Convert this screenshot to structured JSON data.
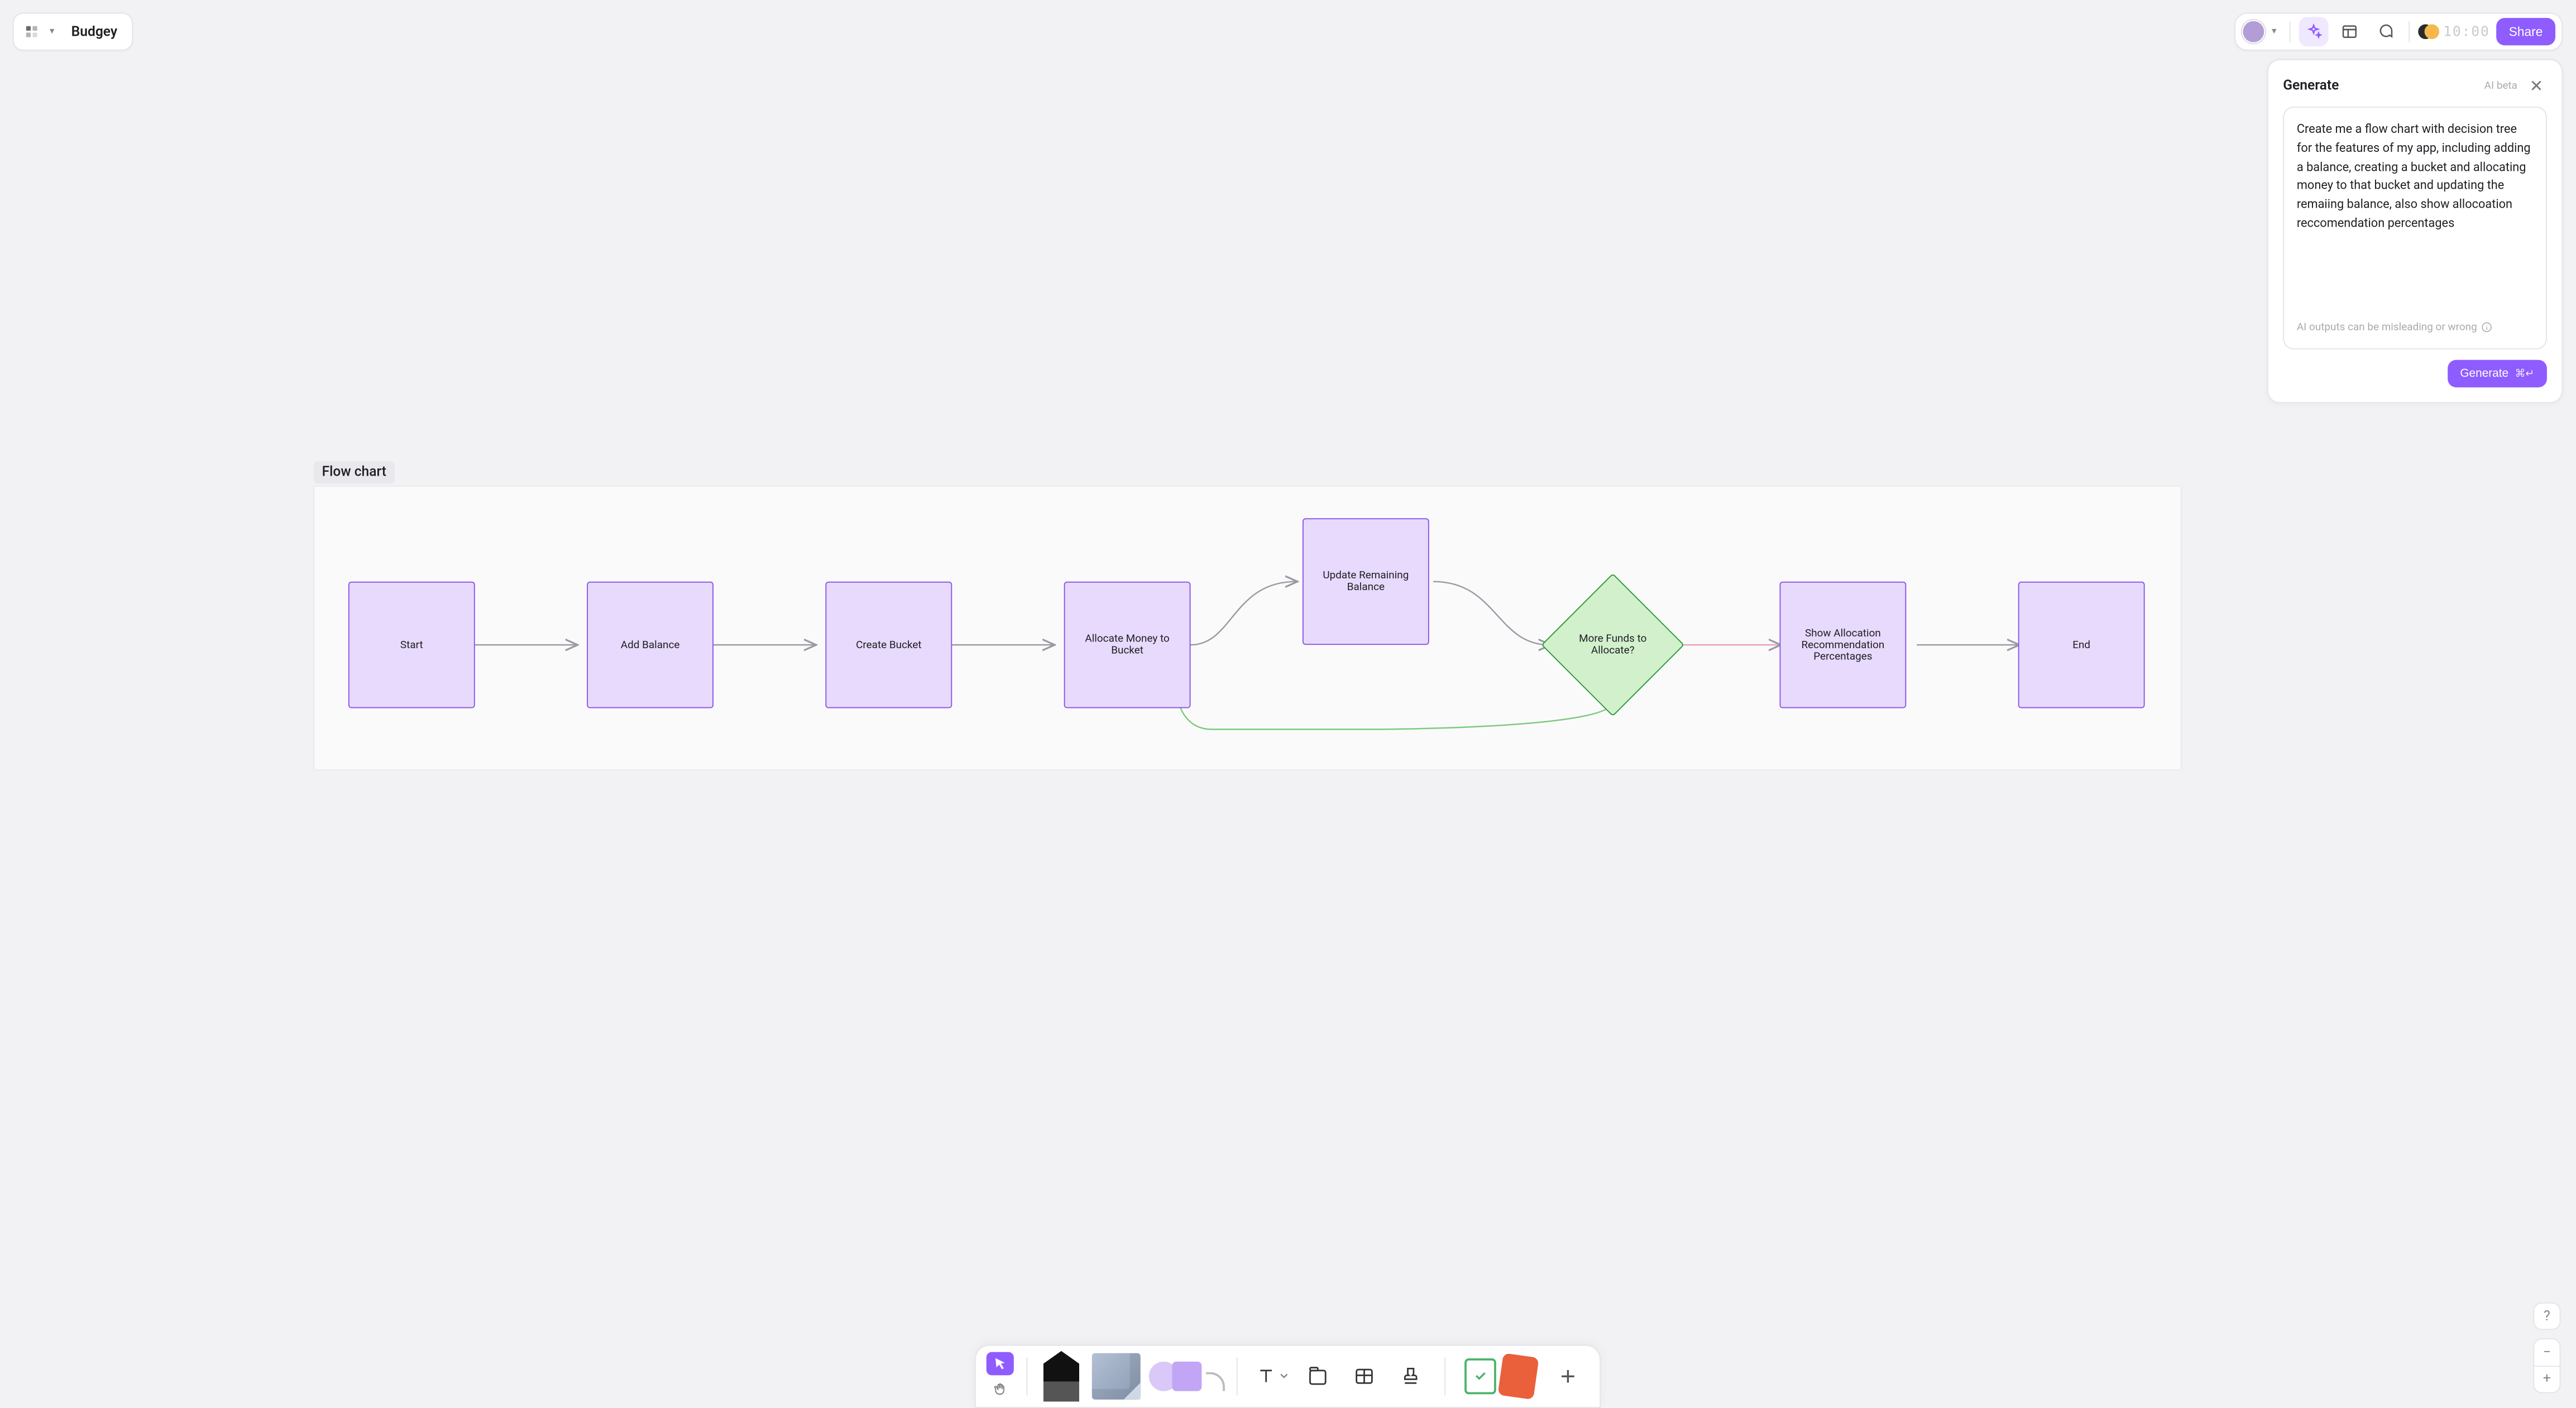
{
  "header": {
    "file_name": "Budgey",
    "share_label": "Share",
    "timer": "10:00"
  },
  "ai": {
    "title": "Generate",
    "badge": "AI beta",
    "prompt": "Create me a flow chart with decision tree for the features of my app, including adding a balance, creating a bucket and allocating money to that bucket and updating the remaiing balance, also show allocoation reccomendation percentages",
    "disclaimer": "AI outputs can be misleading or wrong",
    "generate_label": "Generate",
    "generate_kbd": "⌘↵"
  },
  "canvas": {
    "frame_label": "Flow chart",
    "nodes": {
      "start": "Start",
      "add_balance": "Add Balance",
      "create_bucket": "Create Bucket",
      "allocate": "Allocate Money to Bucket",
      "update": "Update Remaining Balance",
      "decision": "More Funds to Allocate?",
      "show": "Show Allocation Recommendation Percentages",
      "end": "End"
    }
  },
  "bottom": {
    "zoom_in": "+",
    "zoom_out": "−",
    "help": "?"
  }
}
